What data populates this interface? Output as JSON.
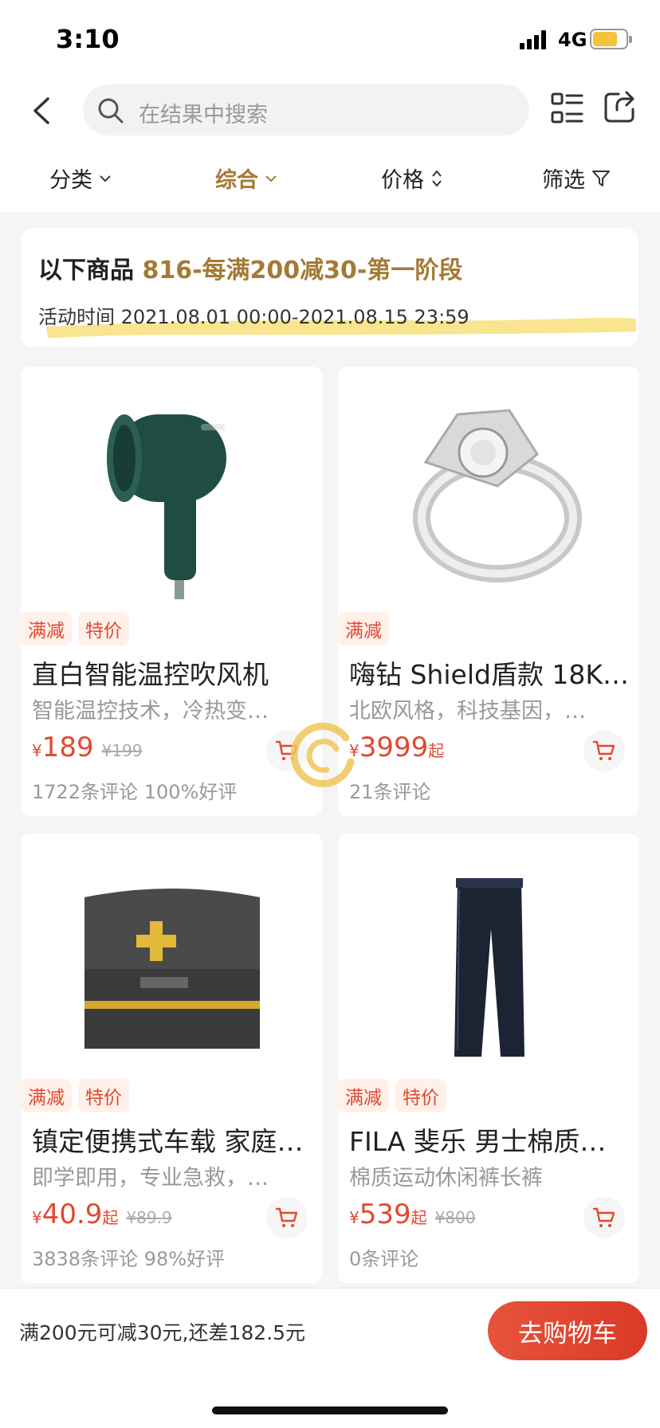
{
  "status_bar": {
    "time": "3:10",
    "network": "4G"
  },
  "header": {
    "search_placeholder": "在结果中搜索"
  },
  "filters": [
    {
      "label": "分类",
      "icon": "chevron-down-icon",
      "active": false
    },
    {
      "label": "综合",
      "icon": "chevron-down-icon",
      "active": true
    },
    {
      "label": "价格",
      "icon": "sort-icon",
      "active": false
    },
    {
      "label": "筛选",
      "icon": "funnel-icon",
      "active": false
    }
  ],
  "banner": {
    "prefix": "以下商品",
    "promo_name": "816-每满200减30-第一阶段",
    "time_range": "活动时间 2021.08.01 00:00-2021.08.15 23:59"
  },
  "products": [
    {
      "tags": [
        "满减",
        "特价"
      ],
      "title": "直白智能温控吹风机",
      "subtitle": "智能温控技术，冷热变…",
      "currency": "¥",
      "price": "189",
      "suffix": "",
      "original_price": "¥199",
      "reviews": "1722条评论 100%好评"
    },
    {
      "tags": [
        "满减"
      ],
      "title": "嗨钻 Shield盾款 18K…",
      "subtitle": "北欧风格，科技基因，…",
      "currency": "¥",
      "price": "3999",
      "suffix": "起",
      "original_price": "",
      "reviews": "21条评论"
    },
    {
      "tags": [
        "满减",
        "特价"
      ],
      "title": "镇定便携式车载 家庭…",
      "subtitle": "即学即用，专业急救，…",
      "currency": "¥",
      "price": "40.9",
      "suffix": "起",
      "original_price": "¥89.9",
      "reviews": "3838条评论 98%好评"
    },
    {
      "tags": [
        "满减",
        "特价"
      ],
      "title": "FILA 斐乐 男士棉质…",
      "subtitle": "棉质运动休闲裤长裤",
      "currency": "¥",
      "price": "539",
      "suffix": "起",
      "original_price": "¥800",
      "reviews": "0条评论"
    }
  ],
  "bottom_bar": {
    "message": "满200元可减30元,还差182.5元",
    "cart_button": "去购物车"
  },
  "colors": {
    "accent_gold": "#a57a36",
    "price_red": "#e2482f",
    "cart_button": "#d93a27"
  }
}
